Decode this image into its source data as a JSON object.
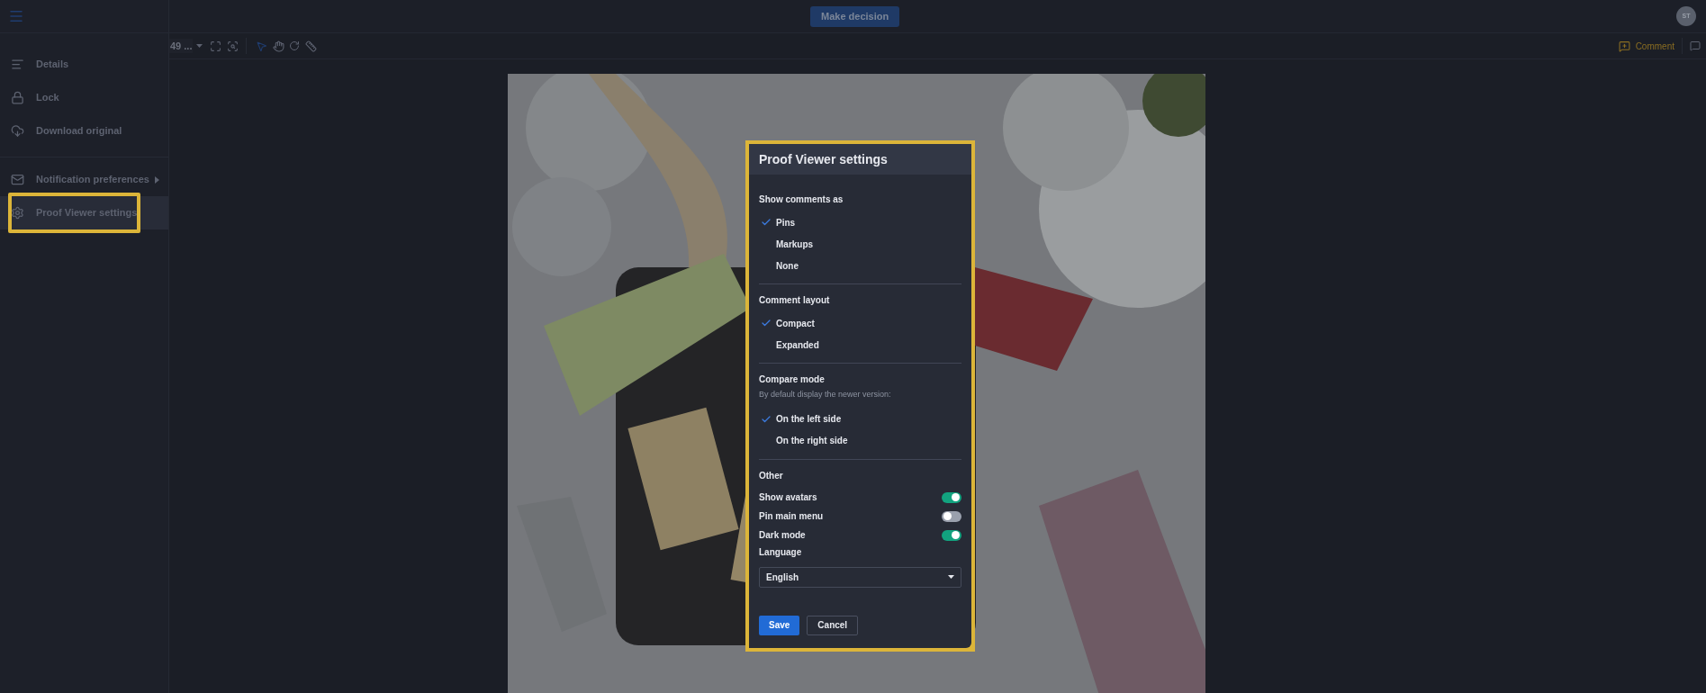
{
  "header": {
    "primary_button": "Make decision",
    "avatar": "ST"
  },
  "toolbar": {
    "zoom_value": "49 ...",
    "comment_button": "Comment"
  },
  "sidebar": {
    "sections": [
      [
        {
          "label": "Details",
          "submenu": false,
          "selected": false,
          "highlighted": false
        },
        {
          "label": "Lock",
          "submenu": false,
          "selected": false,
          "highlighted": false
        },
        {
          "label": "Download original",
          "submenu": false,
          "selected": false,
          "highlighted": false
        }
      ],
      [
        {
          "label": "Notification preferences",
          "submenu": true,
          "selected": false,
          "highlighted": false
        },
        {
          "label": "Proof Viewer settings",
          "submenu": false,
          "selected": true,
          "highlighted": true
        }
      ]
    ]
  },
  "dialog": {
    "title": "Proof Viewer settings",
    "highlighted": true,
    "sections": [
      {
        "title": "Show comments as",
        "options": [
          {
            "label": "Pins",
            "selected": true
          },
          {
            "label": "Markups",
            "selected": false
          },
          {
            "label": "None",
            "selected": false
          }
        ]
      },
      {
        "title": "Comment layout",
        "options": [
          {
            "label": "Compact",
            "selected": true
          },
          {
            "label": "Expanded",
            "selected": false
          }
        ]
      },
      {
        "title": "Compare mode",
        "hint": "By default display the newer version:",
        "options": [
          {
            "label": "On the left side",
            "selected": true
          },
          {
            "label": "On the right side",
            "selected": false
          }
        ]
      }
    ],
    "other": {
      "title": "Other",
      "toggles": [
        {
          "label": "Show avatars",
          "on": true
        },
        {
          "label": "Pin main menu",
          "on": false
        },
        {
          "label": "Dark mode",
          "on": true
        }
      ],
      "language": {
        "label": "Language",
        "value": "English"
      }
    },
    "buttons": [
      {
        "label": "Save",
        "kind": "primary"
      },
      {
        "label": "Cancel",
        "kind": "secondary"
      }
    ]
  }
}
